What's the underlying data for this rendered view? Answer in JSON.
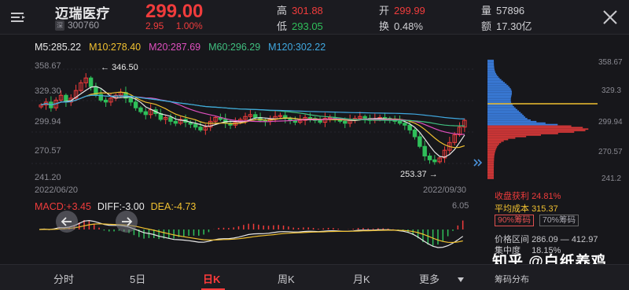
{
  "header": {
    "name": "迈瑞医疗",
    "exchange_badge": "深",
    "code": "300760",
    "price": "299.00",
    "change": "2.95",
    "change_pct": "1.00%",
    "high_label": "高",
    "high": "301.88",
    "low_label": "低",
    "low": "293.05",
    "open_label": "开",
    "open": "299.99",
    "turnover_label": "换",
    "turnover": "0.48%",
    "volume_label": "量",
    "volume": "57896",
    "amount_label": "额",
    "amount": "17.30亿"
  },
  "ma": {
    "m5": "M5:285.22",
    "m10": "M10:278.40",
    "m20": "M20:287.69",
    "m60": "M60:296.29",
    "m120": "M120:302.22"
  },
  "colors": {
    "m5": "#e8e8e8",
    "m10": "#f0c030",
    "m20": "#e050c0",
    "m60": "#40c080",
    "m120": "#40a8e0",
    "up": "#f03c3c",
    "down": "#2fbf5a",
    "bg": "#17171b"
  },
  "price_axis": [
    "358.67",
    "329.30",
    "299.94",
    "270.57",
    "241.20"
  ],
  "annotations": {
    "high": "346.50",
    "low": "253.37"
  },
  "dates": {
    "start": "2022/06/20",
    "end": "2022/09/30"
  },
  "macd": {
    "macd": "MACD:+3.45",
    "diff": "DIFF:-3.00",
    "dea": "DEA:-4.73",
    "scale_top": "6.05"
  },
  "side_axis": [
    "358.67",
    "329.3",
    "299.94",
    "270.57",
    "241.2"
  ],
  "side_stats": {
    "profit_label": "收盘获利",
    "profit": "24.81%",
    "cost_label": "平均成本",
    "cost": "315.37",
    "chip90": "90%筹码",
    "chip70": "70%筹码",
    "range_label": "价格区间",
    "range": "286.09 — 412.97",
    "concentration_label": "集中度",
    "concentration": "18.15%",
    "dist_label": "筹码分布"
  },
  "tabs": [
    "分时",
    "5日",
    "日K",
    "周K",
    "月K",
    "更多"
  ],
  "active_tab": "日K",
  "watermark": "知乎 @白纸养鸡",
  "chart_data": {
    "type": "candlestick",
    "x": [
      "2022/06/20",
      "2022/09/30"
    ],
    "ylim": [
      241.2,
      358.67
    ],
    "annotations": [
      {
        "label": "346.50",
        "kind": "high"
      },
      {
        "label": "253.37",
        "kind": "low"
      }
    ],
    "closes": [
      315,
      318,
      312,
      320,
      325,
      318,
      322,
      330,
      338,
      343,
      334,
      326,
      320,
      318,
      322,
      325,
      328,
      322,
      318,
      312,
      308,
      305,
      310,
      306,
      300,
      302,
      298,
      296,
      300,
      297,
      295,
      292,
      289,
      292,
      298,
      302,
      300,
      296,
      294,
      297,
      300,
      303,
      305,
      302,
      299,
      298,
      300,
      303,
      304,
      301,
      299,
      297,
      299,
      302,
      301,
      299,
      297,
      301,
      302,
      300,
      298,
      296,
      299,
      301,
      303,
      301,
      299,
      300,
      302,
      301,
      300,
      298,
      296,
      294,
      289,
      282,
      272,
      262,
      258,
      256,
      260,
      268,
      276,
      284,
      292,
      299
    ]
  }
}
